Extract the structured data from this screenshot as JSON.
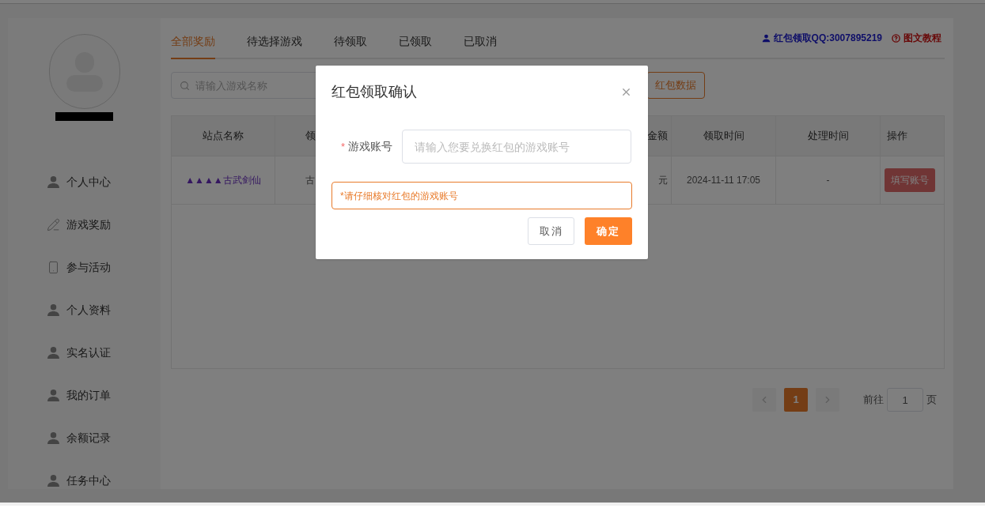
{
  "tabs": [
    {
      "label": "全部奖励",
      "selected": true
    },
    {
      "label": "待选择游戏",
      "selected": false
    },
    {
      "label": "待领取",
      "selected": false
    },
    {
      "label": "已领取",
      "selected": false
    },
    {
      "label": "已取消",
      "selected": false
    }
  ],
  "header_links": [
    {
      "kind": "user",
      "label": "红包领取QQ:3007895219"
    },
    {
      "kind": "help",
      "label": "图文教程"
    }
  ],
  "search": {
    "placeholder": "请输入游戏名称"
  },
  "search_button": "红包数据",
  "sidebar": {
    "items": [
      {
        "kind": "user",
        "label": "个人中心"
      },
      {
        "kind": "pen",
        "label": "游戏奖励"
      },
      {
        "kind": "phone",
        "label": "参与活动"
      },
      {
        "kind": "user",
        "label": "个人资料"
      },
      {
        "kind": "user",
        "label": "实名认证"
      },
      {
        "kind": "user",
        "label": "我的订单"
      },
      {
        "kind": "user",
        "label": "余额记录"
      },
      {
        "kind": "user",
        "label": "任务中心"
      }
    ]
  },
  "table": {
    "columns": [
      "站点名称",
      "领",
      "金额",
      "领取时间",
      "处理时间",
      "操作"
    ],
    "rows": [
      {
        "site": "▲▲▲▲古武剑仙",
        "column_2": "古",
        "amount": "元",
        "claim_time": "2024-11-11 17:05",
        "process_time": "-",
        "action": "填写账号"
      }
    ]
  },
  "pagination": {
    "pages": [
      {
        "label": "1",
        "selected": true
      }
    ],
    "goto_label": "前往",
    "goto_value": "1",
    "page_suffix": "页"
  },
  "dialog": {
    "title": "红包领取确认",
    "field_label": "游戏账号",
    "required_mark": "*",
    "placeholder": "请输入您要兑换红包的游戏账号",
    "notice": "*请仔细核对红包的游戏账号",
    "buttons": [
      {
        "kind": "cancel",
        "label": "取消"
      },
      {
        "kind": "confirm",
        "label": "确定"
      }
    ]
  }
}
